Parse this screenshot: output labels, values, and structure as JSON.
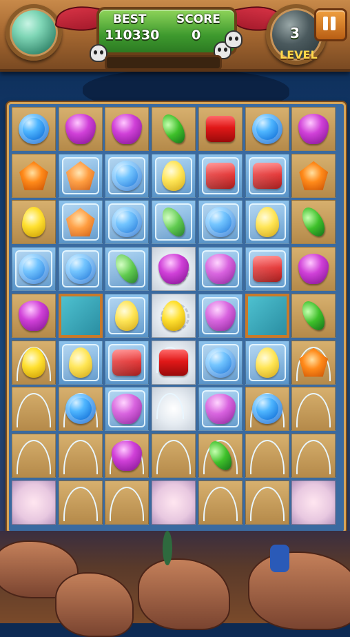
{
  "hud": {
    "best_label": "BEST",
    "score_label": "SCORE",
    "best_value": "110330",
    "score_value": "0",
    "level_number": "3",
    "level_label": "LEVEL",
    "progress": 0.0,
    "pause_icon": "pause-icon"
  },
  "colors": {
    "candy_blue": "#0a66d2",
    "candy_purple": "#d040d8",
    "candy_green": "#3ec02a",
    "candy_red": "#e01818",
    "candy_orange": "#ff8a1a",
    "candy_yellow": "#ffe030",
    "board_frame": "#d6a55a"
  },
  "board": {
    "rows": 9,
    "cols": 7,
    "grid": [
      [
        {
          "bg": "sand",
          "candy": "blue"
        },
        {
          "bg": "sand",
          "candy": "purple"
        },
        {
          "bg": "sand",
          "candy": "purple"
        },
        {
          "bg": "sand",
          "candy": "green"
        },
        {
          "bg": "sand",
          "candy": "red"
        },
        {
          "bg": "sand",
          "candy": "blue"
        },
        {
          "bg": "sand",
          "candy": "purple"
        }
      ],
      [
        {
          "bg": "sand",
          "candy": "orange"
        },
        {
          "bg": "blue",
          "candy": "orange"
        },
        {
          "bg": "blue",
          "candy": "blue"
        },
        {
          "bg": "blue",
          "candy": "yellow"
        },
        {
          "bg": "blue",
          "candy": "red"
        },
        {
          "bg": "blue",
          "candy": "red"
        },
        {
          "bg": "sand",
          "candy": "orange"
        }
      ],
      [
        {
          "bg": "sand",
          "candy": "yellow"
        },
        {
          "bg": "blue",
          "candy": "orange"
        },
        {
          "bg": "blue",
          "candy": "blue"
        },
        {
          "bg": "blue",
          "candy": "green"
        },
        {
          "bg": "blue",
          "candy": "blue"
        },
        {
          "bg": "blue",
          "candy": "yellow"
        },
        {
          "bg": "sand",
          "candy": "green"
        }
      ],
      [
        {
          "bg": "blue",
          "candy": "blue"
        },
        {
          "bg": "blue",
          "candy": "blue"
        },
        {
          "bg": "blue",
          "candy": "green"
        },
        {
          "bg": "cream",
          "candy": "purple"
        },
        {
          "bg": "blue",
          "candy": "purple"
        },
        {
          "bg": "blue",
          "candy": "red"
        },
        {
          "bg": "sand",
          "candy": "purple"
        }
      ],
      [
        {
          "bg": "sand",
          "candy": "purple"
        },
        {
          "bg": "glass",
          "candy": ""
        },
        {
          "bg": "blue",
          "candy": "yellow"
        },
        {
          "bg": "cream",
          "candy": "yellow"
        },
        {
          "bg": "blue",
          "candy": "purple"
        },
        {
          "bg": "glass",
          "candy": ""
        },
        {
          "bg": "sand",
          "candy": "green"
        }
      ],
      [
        {
          "bg": "tent",
          "candy": "yellow"
        },
        {
          "bg": "blue",
          "candy": "yellow"
        },
        {
          "bg": "blue",
          "candy": "red"
        },
        {
          "bg": "cream-tent",
          "candy": "red"
        },
        {
          "bg": "blue",
          "candy": "blue"
        },
        {
          "bg": "blue",
          "candy": "yellow"
        },
        {
          "bg": "tent",
          "candy": "orange"
        }
      ],
      [
        {
          "bg": "tent",
          "candy": ""
        },
        {
          "bg": "tent",
          "candy": "blue"
        },
        {
          "bg": "blue",
          "candy": "purple"
        },
        {
          "bg": "cream-tent",
          "candy": ""
        },
        {
          "bg": "blue",
          "candy": "purple"
        },
        {
          "bg": "tent",
          "candy": "blue"
        },
        {
          "bg": "tent",
          "candy": ""
        }
      ],
      [
        {
          "bg": "tent",
          "candy": ""
        },
        {
          "bg": "tent",
          "candy": ""
        },
        {
          "bg": "tent",
          "candy": "purple"
        },
        {
          "bg": "tent",
          "candy": ""
        },
        {
          "bg": "tent",
          "candy": "green"
        },
        {
          "bg": "tent",
          "candy": ""
        },
        {
          "bg": "tent",
          "candy": ""
        }
      ],
      [
        {
          "bg": "pink",
          "candy": ""
        },
        {
          "bg": "tent",
          "candy": ""
        },
        {
          "bg": "tent",
          "candy": ""
        },
        {
          "bg": "pink",
          "candy": ""
        },
        {
          "bg": "tent",
          "candy": ""
        },
        {
          "bg": "tent",
          "candy": ""
        },
        {
          "bg": "pink",
          "candy": ""
        }
      ]
    ]
  }
}
